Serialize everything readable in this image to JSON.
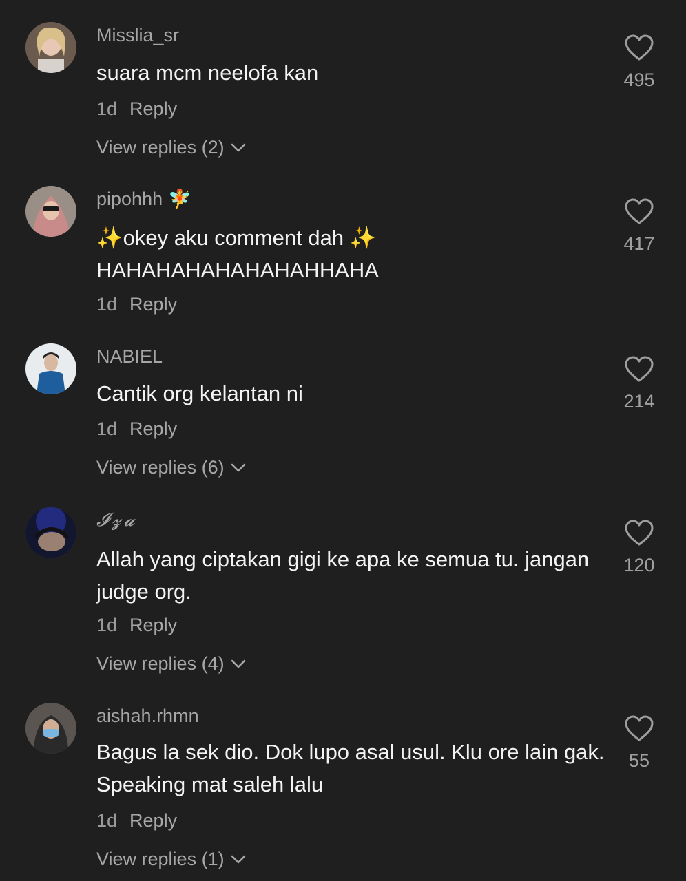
{
  "comments": [
    {
      "username": "Misslia_sr",
      "text": "suara mcm neelofa kan",
      "time": "1d",
      "reply_label": "Reply",
      "view_replies": "View replies (2)",
      "likes": "495"
    },
    {
      "username": "pipohhh",
      "username_emoji": "🧚",
      "sparkle_left": "✨",
      "text": "okey aku comment dah",
      "sparkle_right": "✨",
      "text_line2": "HAHAHAHAHAHAHAHHAHA",
      "time": "1d",
      "reply_label": "Reply",
      "likes": "417"
    },
    {
      "username": "NABIEL",
      "text": "Cantik org kelantan ni",
      "time": "1d",
      "reply_label": "Reply",
      "view_replies": "View replies (6)",
      "likes": "214"
    },
    {
      "username": "𝓘𝔃𝓪",
      "text": "Allah yang ciptakan gigi ke apa ke semua tu. jangan judge org.",
      "time": "1d",
      "reply_label": "Reply",
      "view_replies": "View replies (4)",
      "likes": "120"
    },
    {
      "username": "aishah.rhmn",
      "text": "Bagus la sek dio. Dok lupo asal usul. Klu ore lain gak. Speaking mat saleh lalu",
      "time": "1d",
      "reply_label": "Reply",
      "view_replies": "View replies (1)",
      "likes": "55"
    }
  ]
}
